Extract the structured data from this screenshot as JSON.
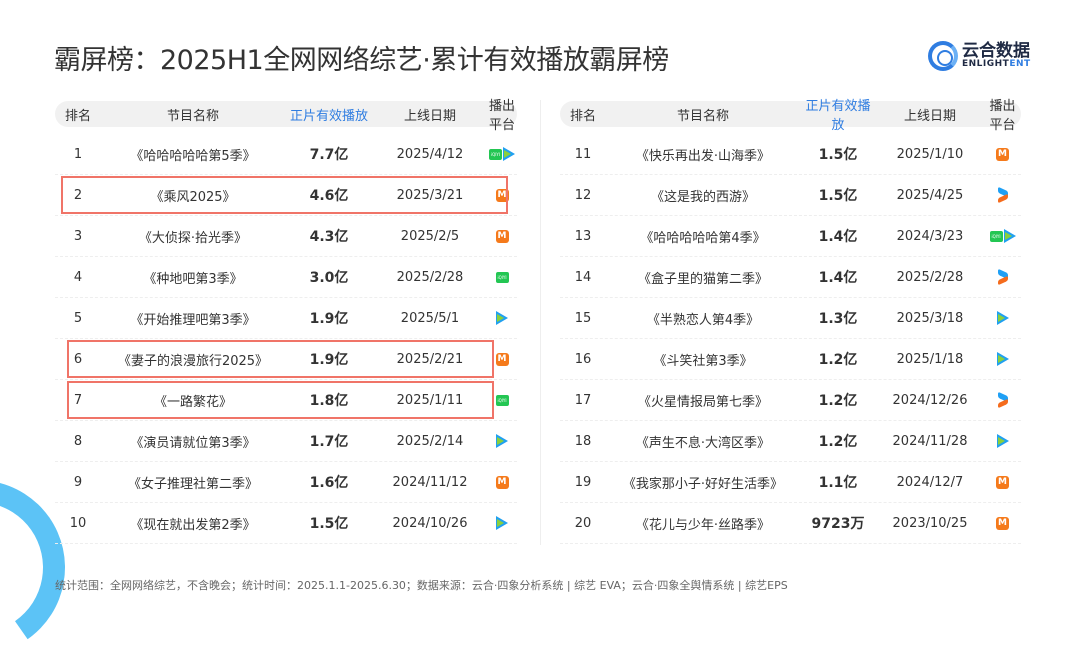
{
  "title": "霸屏榜：2025H1全网网络综艺·累计有效播放霸屏榜",
  "logo": {
    "cn": "云合数据",
    "en_a": "ENLIGHT",
    "en_b": "ENT"
  },
  "headers": {
    "rank": "排名",
    "name": "节目名称",
    "plays": "正片有效播放",
    "date": "上线日期",
    "platform": "播出平台"
  },
  "left": [
    {
      "rank": "1",
      "name": "《哈哈哈哈哈第5季》",
      "plays": "7.7亿",
      "date": "2025/4/12",
      "platform": [
        "iqiyi",
        "tencent"
      ]
    },
    {
      "rank": "2",
      "name": "《乘风2025》",
      "plays": "4.6亿",
      "date": "2025/3/21",
      "platform": [
        "mango"
      ],
      "highlight": true
    },
    {
      "rank": "3",
      "name": "《大侦探·拾光季》",
      "plays": "4.3亿",
      "date": "2025/2/5",
      "platform": [
        "mango"
      ]
    },
    {
      "rank": "4",
      "name": "《种地吧第3季》",
      "plays": "3.0亿",
      "date": "2025/2/28",
      "platform": [
        "iqiyi"
      ]
    },
    {
      "rank": "5",
      "name": "《开始推理吧第3季》",
      "plays": "1.9亿",
      "date": "2025/5/1",
      "platform": [
        "tencent"
      ]
    },
    {
      "rank": "6",
      "name": "《妻子的浪漫旅行2025》",
      "plays": "1.9亿",
      "date": "2025/2/21",
      "platform": [
        "mango"
      ],
      "highlight": true
    },
    {
      "rank": "7",
      "name": "《一路繁花》",
      "plays": "1.8亿",
      "date": "2025/1/11",
      "platform": [
        "iqiyi"
      ],
      "highlight": true
    },
    {
      "rank": "8",
      "name": "《演员请就位第3季》",
      "plays": "1.7亿",
      "date": "2025/2/14",
      "platform": [
        "tencent"
      ]
    },
    {
      "rank": "9",
      "name": "《女子推理社第二季》",
      "plays": "1.6亿",
      "date": "2024/11/12",
      "platform": [
        "mango"
      ]
    },
    {
      "rank": "10",
      "name": "《现在就出发第2季》",
      "plays": "1.5亿",
      "date": "2024/10/26",
      "platform": [
        "tencent"
      ]
    }
  ],
  "right": [
    {
      "rank": "11",
      "name": "《快乐再出发·山海季》",
      "plays": "1.5亿",
      "date": "2025/1/10",
      "platform": [
        "mango"
      ]
    },
    {
      "rank": "12",
      "name": "《这是我的西游》",
      "plays": "1.5亿",
      "date": "2025/4/25",
      "platform": [
        "youku"
      ]
    },
    {
      "rank": "13",
      "name": "《哈哈哈哈哈第4季》",
      "plays": "1.4亿",
      "date": "2024/3/23",
      "platform": [
        "iqiyi",
        "tencent"
      ]
    },
    {
      "rank": "14",
      "name": "《盒子里的猫第二季》",
      "plays": "1.4亿",
      "date": "2025/2/28",
      "platform": [
        "youku"
      ]
    },
    {
      "rank": "15",
      "name": "《半熟恋人第4季》",
      "plays": "1.3亿",
      "date": "2025/3/18",
      "platform": [
        "tencent"
      ]
    },
    {
      "rank": "16",
      "name": "《斗笑社第3季》",
      "plays": "1.2亿",
      "date": "2025/1/18",
      "platform": [
        "tencent"
      ]
    },
    {
      "rank": "17",
      "name": "《火星情报局第七季》",
      "plays": "1.2亿",
      "date": "2024/12/26",
      "platform": [
        "youku"
      ]
    },
    {
      "rank": "18",
      "name": "《声生不息·大湾区季》",
      "plays": "1.2亿",
      "date": "2024/11/28",
      "platform": [
        "tencent"
      ]
    },
    {
      "rank": "19",
      "name": "《我家那小子·好好生活季》",
      "plays": "1.1亿",
      "date": "2024/12/7",
      "platform": [
        "mango"
      ]
    },
    {
      "rank": "20",
      "name": "《花儿与少年·丝路季》",
      "plays": "9723万",
      "date": "2023/10/25",
      "platform": [
        "mango"
      ]
    }
  ],
  "footer": "统计范围：全网网络综艺，不含晚会；统计时间：2025.1.1-2025.6.30；数据来源：云合·四象分析系统 | 综艺 EVA；云合·四象全舆情系统 | 综艺EPS",
  "colors": {
    "accent": "#2f7de1",
    "highlight": "#f07468"
  }
}
